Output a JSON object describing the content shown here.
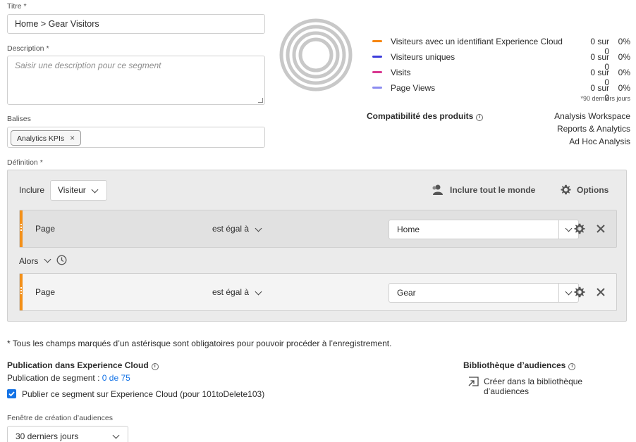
{
  "form": {
    "title_label": "Titre",
    "title_value": "Home > Gear Visitors",
    "description_label": "Description",
    "description_placeholder": "Saisir une description pour ce segment",
    "tags_label": "Balises",
    "tag": "Analytics KPIs",
    "tag_remove": "×",
    "definition_label": "Définition",
    "required_mark": "*"
  },
  "summary": {
    "rows": [
      {
        "label": "Visiteurs avec un identifiant Experience Cloud",
        "count": "0 sur 0",
        "pct": "0%",
        "color": "#f68511"
      },
      {
        "label": "Visiteurs uniques",
        "count": "0 sur 0",
        "pct": "0%",
        "color": "#3d3ddb"
      },
      {
        "label": "Visits",
        "count": "0 sur 0",
        "pct": "0%",
        "color": "#d83790"
      },
      {
        "label": "Page Views",
        "count": "0 sur 0",
        "pct": "0%",
        "color": "#8c8cf0"
      }
    ],
    "period_note": "*90 derniers jours",
    "compat_title": "Compatibilité des produits",
    "compat_products": [
      "Analysis Workspace",
      "Reports & Analytics",
      "Ad Hoc Analysis"
    ]
  },
  "definition": {
    "include_label": "Inclure",
    "container_value": "Visiteur",
    "include_everyone": "Inclure tout le monde",
    "options": "Options",
    "then_label": "Alors",
    "rules": [
      {
        "dimension": "Page",
        "operator": "est égal à",
        "value": "Home"
      },
      {
        "dimension": "Page",
        "operator": "est égal à",
        "value": "Gear"
      }
    ]
  },
  "footer": {
    "required_note": "* Tous les champs marqués d’un astérisque sont obligatoires pour pouvoir procéder à l’enregistrement.",
    "publish_title": "Publication dans Experience Cloud",
    "publish_count_label": "Publication de segment :",
    "publish_count_value": "0 de 75",
    "publish_checkbox_label": "Publier ce segment sur Experience Cloud (pour 101toDelete103)",
    "audience_library_title": "Bibliothèque d’audiences",
    "create_in_library": "Créer dans la bibliothèque d’audiences",
    "window_label": "Fenêtre de création d’audiences",
    "window_value": "30 derniers jours"
  },
  "colors": {
    "accent": "#1473e6",
    "rule_bar": "#f39019",
    "ring": "#c8c8c8"
  }
}
